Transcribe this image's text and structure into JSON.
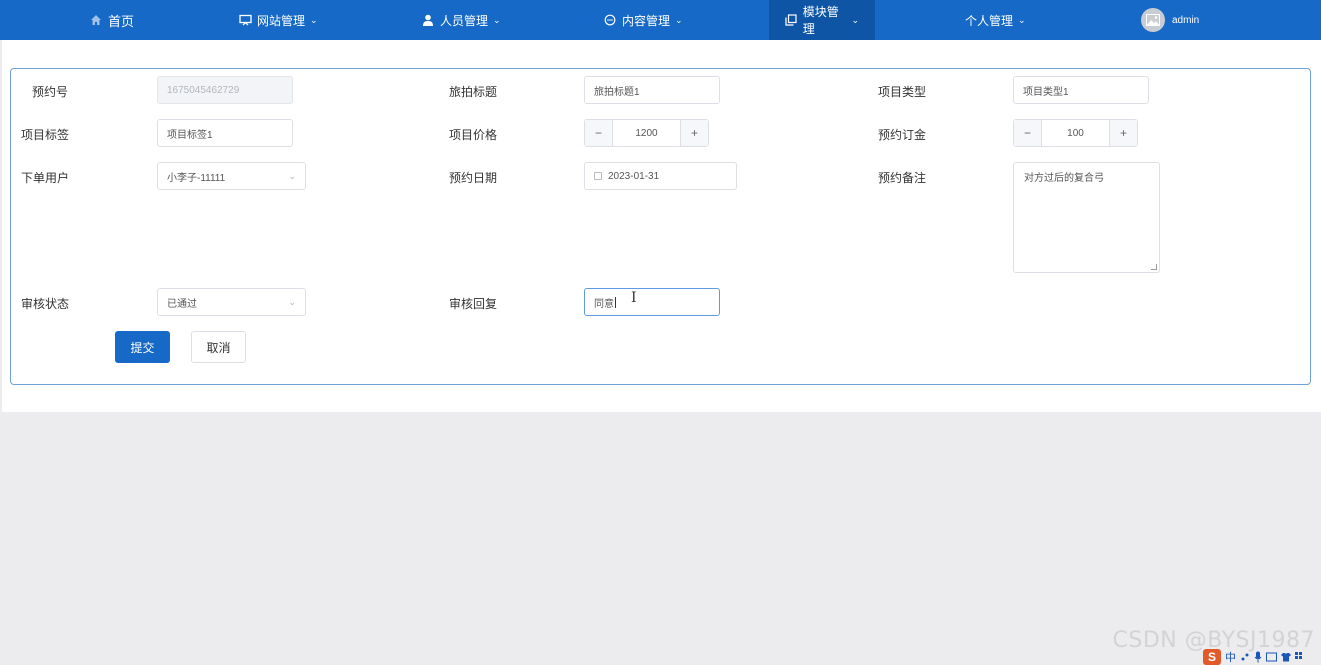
{
  "nav": {
    "items": [
      {
        "label": "首页",
        "icon": "home-icon"
      },
      {
        "label": "网站管理",
        "icon": "monitor-icon"
      },
      {
        "label": "人员管理",
        "icon": "user-icon"
      },
      {
        "label": "内容管理",
        "icon": "chat-icon"
      },
      {
        "label": "模块管理",
        "icon": "copy-icon"
      },
      {
        "label": "个人管理",
        "icon": ""
      }
    ],
    "active_index": 4,
    "username": "admin",
    "colors": {
      "bar": "#1669c6",
      "active": "#0f55a5"
    }
  },
  "form": {
    "booking_no": {
      "label": "预约号",
      "value": "1675045462729"
    },
    "photo_title": {
      "label": "旅拍标题",
      "value": "旅拍标题1"
    },
    "project_type": {
      "label": "项目类型",
      "value": "项目类型1"
    },
    "project_tag": {
      "label": "项目标签",
      "value": "项目标签1"
    },
    "project_price": {
      "label": "项目价格",
      "value": "1200",
      "minus": "−",
      "plus": "+"
    },
    "deposit": {
      "label": "预约订金",
      "value": "100",
      "minus": "−",
      "plus": "+"
    },
    "order_user": {
      "label": "下单用户",
      "value": "小李子-11111"
    },
    "booking_date": {
      "label": "预约日期",
      "value": "2023-01-31"
    },
    "booking_note": {
      "label": "预约备注",
      "value": "对方过后的复合弓"
    },
    "review_status": {
      "label": "审核状态",
      "value": "已通过"
    },
    "review_reply": {
      "label": "审核回复",
      "value": "同意"
    },
    "submit_label": "提交",
    "cancel_label": "取消"
  },
  "watermark": "CSDN @BYSJ1987",
  "tray": {
    "ime_label": "中"
  }
}
